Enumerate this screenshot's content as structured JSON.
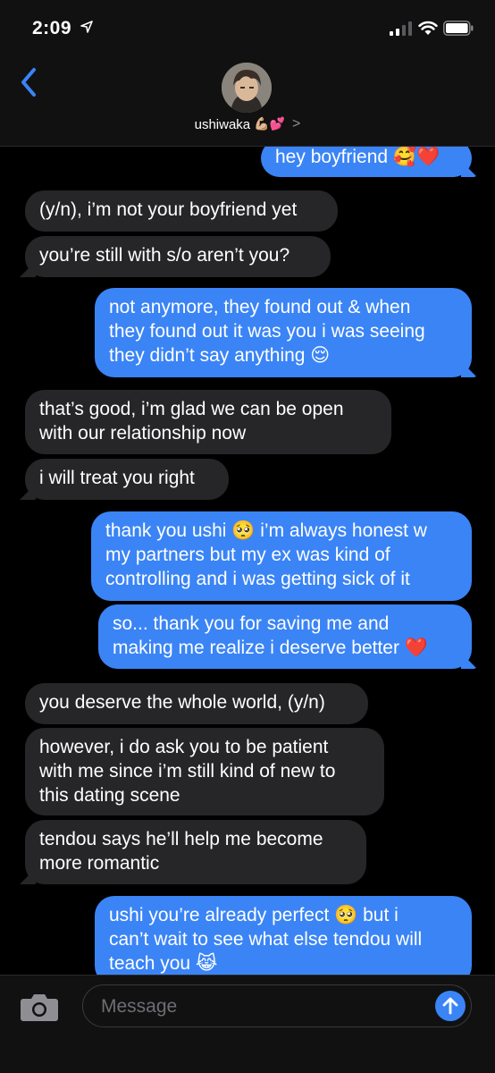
{
  "status": {
    "time": "2:09"
  },
  "header": {
    "contact_name": "ushiwaka",
    "contact_emoji": "💪🏼💕",
    "chevron": ">"
  },
  "messages": [
    {
      "from": "me",
      "text": "hey boyfriend 🥰❤️"
    },
    {
      "from": "them",
      "text": "(y/n), i’m not your boyfriend yet"
    },
    {
      "from": "them",
      "text": "you’re still with s/o aren’t you?"
    },
    {
      "from": "me",
      "lines": [
        "not anymore, they found out & when",
        "they found out it was you i was seeing",
        "they didn’t say anything 😌"
      ]
    },
    {
      "from": "them",
      "lines": [
        "that’s good, i’m glad we can be open",
        "with our relationship now"
      ]
    },
    {
      "from": "them",
      "text": "i will treat you right"
    },
    {
      "from": "me",
      "lines": [
        "thank you ushi 🥺 i’m always honest w",
        "my partners but my ex was kind of",
        "controlling and i was getting sick of it"
      ]
    },
    {
      "from": "me",
      "lines": [
        "so... thank you for saving me and",
        "making me realize i deserve better ❤️"
      ]
    },
    {
      "from": "them",
      "text": "you deserve the whole world, (y/n)"
    },
    {
      "from": "them",
      "lines": [
        "however, i do ask you to be patient",
        "with me since i’m still kind of new to",
        "this dating scene"
      ]
    },
    {
      "from": "them",
      "lines": [
        "tendou says he’ll help me become",
        "more romantic"
      ]
    },
    {
      "from": "me",
      "lines": [
        "ushi you’re already perfect 🥺 but i",
        "can’t wait to see what else tendou will",
        "teach you 😹"
      ]
    }
  ],
  "input": {
    "placeholder": "Message"
  },
  "colors": {
    "sent_bubble": "#3a84f6",
    "received_bubble": "#262628",
    "accent": "#3a84f6"
  }
}
